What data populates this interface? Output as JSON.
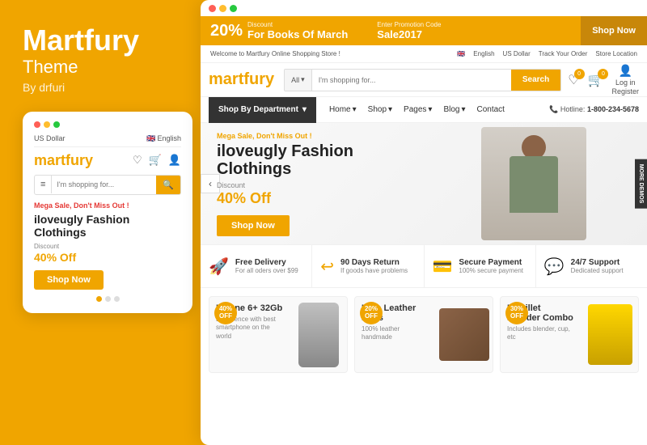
{
  "brand": {
    "name": "Martfury",
    "subtitle": "Theme",
    "by": "By drfuri"
  },
  "promo_bar": {
    "percent": "20%",
    "discount_label": "Discount",
    "title": "For Books Of March",
    "enter_code_label": "Enter Promotion Code",
    "code": "Sale2017",
    "shop_btn": "Shop Now"
  },
  "info_bar": {
    "welcome": "Welcome to Martfury Online Shopping Store !",
    "language": "English",
    "currency": "US Dollar",
    "track_order": "Track Your Order",
    "store_location": "Store Location"
  },
  "nav": {
    "logo_first": "mart",
    "logo_second": "fury",
    "search_category": "All",
    "search_placeholder": "I'm shopping for...",
    "search_btn": "Search",
    "login_label": "Log in",
    "register_label": "Register"
  },
  "menu": {
    "shop_by": "Shop By Department",
    "items": [
      "Home",
      "Shop",
      "Pages",
      "Blog",
      "Contact"
    ],
    "hotline_label": "Hotline:",
    "hotline_number": "1-800-234-5678"
  },
  "hero": {
    "sale_label": "Mega Sale, Don't Miss Out !",
    "heading_line1": "iloveugly Fashion",
    "heading_line2": "Clothings",
    "discount_label": "Discount",
    "discount_value": "40% Off",
    "shop_btn": "Shop Now",
    "more_demos": "MORE DEMOS"
  },
  "features": [
    {
      "icon": "🚀",
      "title": "Free Delivery",
      "desc": "For all oders over $99"
    },
    {
      "icon": "↩",
      "title": "90 Days Return",
      "desc": "If goods have problems"
    },
    {
      "icon": "💳",
      "title": "Secure Payment",
      "desc": "100% secure payment"
    },
    {
      "icon": "💬",
      "title": "24/7 Support",
      "desc": "Dedicated support"
    }
  ],
  "products": [
    {
      "name": "Iphone 6+ 32Gb",
      "desc": "Experience with best smartphone on the world",
      "badge": "40% OFF"
    },
    {
      "name": "Unio Leather Bags",
      "desc": "100% leather handmade",
      "badge": "20% OFF"
    },
    {
      "name": "Nutrillet Blender Combo",
      "desc": "Includes blender, cup, etc",
      "badge": "30% OFF"
    }
  ],
  "mobile": {
    "logo_first": "mart",
    "logo_second": "fury",
    "currency": "US Dollar",
    "language": "English",
    "search_placeholder": "I'm shopping for...",
    "sale_label": "Mega Sale, Don't Miss Out !",
    "heading_line1": "iloveugly Fashion",
    "heading_line2": "Clothings",
    "discount_label": "Discount",
    "discount_value": "40% Off",
    "shop_btn": "Shop Now"
  }
}
